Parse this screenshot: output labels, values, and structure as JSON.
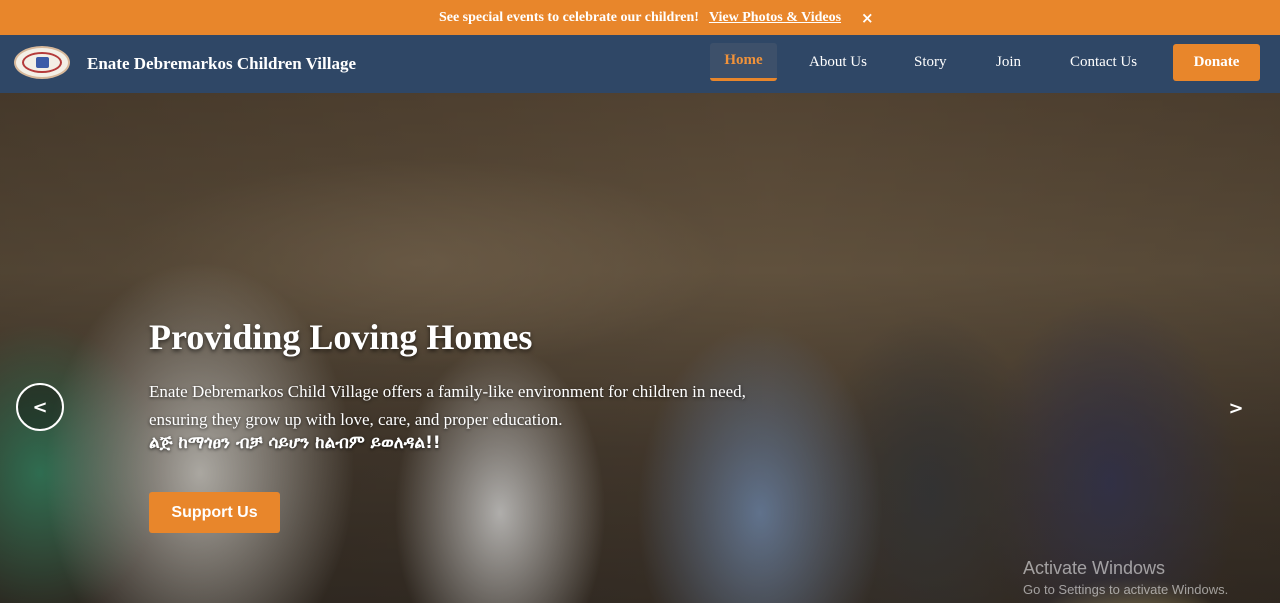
{
  "announcement": {
    "text": "See special events to celebrate our children!",
    "link": "View Photos & Videos",
    "close": "×"
  },
  "navbar": {
    "brand": "Enate Debremarkos Children Village",
    "links": [
      "Home",
      "About Us",
      "Story",
      "Join",
      "Contact Us"
    ],
    "donate": "Donate"
  },
  "hero": {
    "title": "Providing Loving Homes",
    "description": "Enate Debremarkos Child Village offers a family-like environment for children in need, ensuring they grow up with love, care, and proper education.",
    "amharic": "ልጅ ከማጎፀን ብቻ ሳይሆን ከልብም ይወለዳል!!",
    "cta": "Support Us",
    "prev": "<",
    "next": ">"
  },
  "watermark": {
    "line1": "Activate Windows",
    "line2": "Go to Settings to activate Windows."
  },
  "colors": {
    "accent": "#e8862b",
    "navbar": "#2f4766"
  }
}
